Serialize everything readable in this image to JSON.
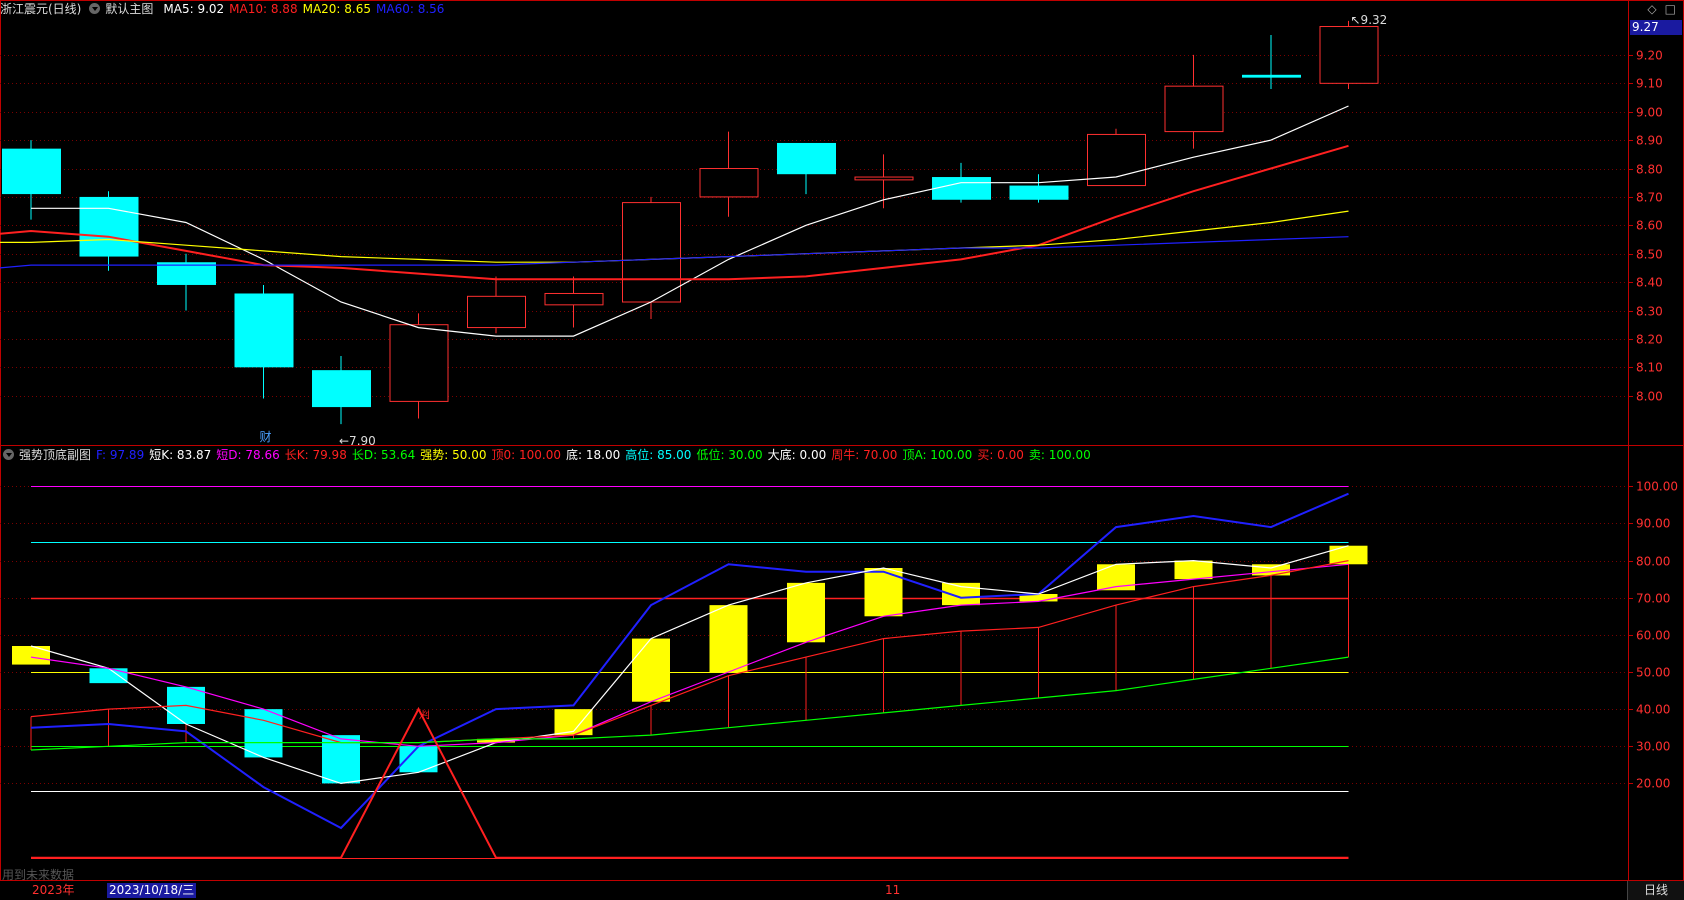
{
  "main_legend": {
    "stock_name": "浙江震元(日线)",
    "chart_name": "默认主图",
    "items": [
      {
        "label": "MA5: 9.02",
        "color": "#ffffff"
      },
      {
        "label": "MA10: 8.88",
        "color": "#ff2020"
      },
      {
        "label": "MA20: 8.65",
        "color": "#ffff00"
      },
      {
        "label": "MA60: 8.56",
        "color": "#2020ff"
      }
    ]
  },
  "sub_legend": {
    "chart_name": "强势顶底副图",
    "items": [
      {
        "label": "F: 97.89",
        "color": "#2020ff"
      },
      {
        "label": "短K: 83.87",
        "color": "#ffffff"
      },
      {
        "label": "短D: 78.66",
        "color": "#ff00ff"
      },
      {
        "label": "长K: 79.98",
        "color": "#ff2020"
      },
      {
        "label": "长D: 53.64",
        "color": "#00ff00"
      },
      {
        "label": "强势: 50.00",
        "color": "#ffff00"
      },
      {
        "label": "顶0: 100.00",
        "color": "#ff2020"
      },
      {
        "label": "底: 18.00",
        "color": "#ffffff"
      },
      {
        "label": "高位: 85.00",
        "color": "#00ffff"
      },
      {
        "label": "低位: 30.00",
        "color": "#00ff00"
      },
      {
        "label": "大底: 0.00",
        "color": "#ffffff"
      },
      {
        "label": "周牛: 70.00",
        "color": "#ff2020"
      },
      {
        "label": "顶A: 100.00",
        "color": "#00ff00"
      },
      {
        "label": "买: 0.00",
        "color": "#ff2020"
      },
      {
        "label": "卖: 100.00",
        "color": "#00ff00"
      }
    ]
  },
  "current_price": "9.27",
  "annotations": {
    "high_label": "9.32",
    "low_label": "7.90",
    "cai_marker": "财",
    "buy_marker": "买",
    "future_note": "用到未来数据"
  },
  "x_axis": {
    "year": "2023年",
    "date_cursor": "2023/10/18/三",
    "month_mark": "11",
    "period": "日线"
  },
  "top_icons": [
    "◇",
    "□"
  ],
  "colors": {
    "up": "#ff3030",
    "down": "#00ffff",
    "grid": "#7a0000",
    "axis": "#c00000",
    "yellow": "#ffff00"
  },
  "chart_data": [
    {
      "type": "candlestick",
      "title": "浙江震元(日线)",
      "ylim": [
        7.83,
        9.33
      ],
      "yticks": [
        8.0,
        8.1,
        8.2,
        8.3,
        8.4,
        8.5,
        8.6,
        8.7,
        8.8,
        8.9,
        9.0,
        9.1,
        9.2
      ],
      "candles": [
        {
          "o": 8.87,
          "h": 8.9,
          "l": 8.62,
          "c": 8.71
        },
        {
          "o": 8.7,
          "h": 8.72,
          "l": 8.44,
          "c": 8.49
        },
        {
          "o": 8.47,
          "h": 8.5,
          "l": 8.3,
          "c": 8.39
        },
        {
          "o": 8.36,
          "h": 8.39,
          "l": 7.99,
          "c": 8.1
        },
        {
          "o": 8.09,
          "h": 8.14,
          "l": 7.9,
          "c": 7.96
        },
        {
          "o": 7.98,
          "h": 8.29,
          "l": 7.92,
          "c": 8.25
        },
        {
          "o": 8.24,
          "h": 8.42,
          "l": 8.22,
          "c": 8.35
        },
        {
          "o": 8.32,
          "h": 8.42,
          "l": 8.24,
          "c": 8.36
        },
        {
          "o": 8.33,
          "h": 8.7,
          "l": 8.27,
          "c": 8.68
        },
        {
          "o": 8.7,
          "h": 8.93,
          "l": 8.63,
          "c": 8.8
        },
        {
          "o": 8.89,
          "h": 8.89,
          "l": 8.71,
          "c": 8.78
        },
        {
          "o": 8.76,
          "h": 8.85,
          "l": 8.66,
          "c": 8.77
        },
        {
          "o": 8.77,
          "h": 8.82,
          "l": 8.68,
          "c": 8.69
        },
        {
          "o": 8.74,
          "h": 8.78,
          "l": 8.68,
          "c": 8.69
        },
        {
          "o": 8.74,
          "h": 8.94,
          "l": 8.74,
          "c": 8.92
        },
        {
          "o": 8.93,
          "h": 9.2,
          "l": 8.87,
          "c": 9.09
        },
        {
          "o": 9.13,
          "h": 9.27,
          "l": 9.08,
          "c": 9.12
        },
        {
          "o": 9.1,
          "h": 9.32,
          "l": 9.08,
          "c": 9.3
        }
      ],
      "series": [
        {
          "name": "MA5",
          "color": "#ffffff",
          "values": [
            8.66,
            8.66,
            8.61,
            8.48,
            8.33,
            8.24,
            8.21,
            8.21,
            8.33,
            8.48,
            8.6,
            8.69,
            8.75,
            8.75,
            8.77,
            8.84,
            8.9,
            9.02
          ]
        },
        {
          "name": "MA10",
          "color": "#ff2020",
          "values": [
            8.57,
            8.58,
            8.56,
            8.51,
            8.46,
            8.45,
            8.43,
            8.41,
            8.41,
            8.41,
            8.41,
            8.42,
            8.45,
            8.48,
            8.53,
            8.63,
            8.72,
            8.8,
            8.88
          ]
        },
        {
          "name": "MA20",
          "color": "#ffff00",
          "values": [
            8.54,
            8.54,
            8.55,
            8.53,
            8.51,
            8.49,
            8.48,
            8.47,
            8.47,
            8.48,
            8.49,
            8.5,
            8.51,
            8.52,
            8.53,
            8.55,
            8.58,
            8.61,
            8.65
          ]
        },
        {
          "name": "MA60",
          "color": "#2020ff",
          "values": [
            8.45,
            8.46,
            8.46,
            8.46,
            8.46,
            8.46,
            8.46,
            8.46,
            8.47,
            8.48,
            8.49,
            8.5,
            8.51,
            8.52,
            8.52,
            8.53,
            8.54,
            8.55,
            8.56
          ]
        }
      ]
    },
    {
      "type": "line",
      "title": "强势顶底副图",
      "ylim": [
        -6,
        106
      ],
      "yticks": [
        20,
        30,
        40,
        50,
        60,
        70,
        80,
        90,
        100
      ],
      "hlines": [
        {
          "value": 100,
          "color": "#ff00ff"
        },
        {
          "value": 85,
          "color": "#00ffff"
        },
        {
          "value": 70,
          "color": "#ff2020"
        },
        {
          "value": 50,
          "color": "#ffff00"
        },
        {
          "value": 30,
          "color": "#00ff00"
        },
        {
          "value": 18,
          "color": "#ffffff"
        },
        {
          "value": 0,
          "color": "#ff2020"
        }
      ],
      "boxes": [
        {
          "a": 57,
          "b": 52,
          "color": "yellow"
        },
        {
          "a": 51,
          "b": 47,
          "color": "cyan"
        },
        {
          "a": 46,
          "b": 36,
          "color": "cyan"
        },
        {
          "a": 40,
          "b": 27,
          "color": "cyan"
        },
        {
          "a": 33,
          "b": 20,
          "color": "cyan"
        },
        {
          "a": 30,
          "b": 23,
          "color": "cyan"
        },
        {
          "a": 32,
          "b": 31,
          "color": "yellow"
        },
        {
          "a": 40,
          "b": 33,
          "color": "yellow"
        },
        {
          "a": 59,
          "b": 42,
          "color": "yellow"
        },
        {
          "a": 68,
          "b": 50,
          "color": "yellow"
        },
        {
          "a": 74,
          "b": 58,
          "color": "yellow"
        },
        {
          "a": 78,
          "b": 65,
          "color": "yellow"
        },
        {
          "a": 74,
          "b": 68,
          "color": "yellow"
        },
        {
          "a": 71,
          "b": 69,
          "color": "yellow"
        },
        {
          "a": 79,
          "b": 72,
          "color": "yellow"
        },
        {
          "a": 80,
          "b": 75,
          "color": "yellow"
        },
        {
          "a": 79,
          "b": 76,
          "color": "yellow"
        },
        {
          "a": 84,
          "b": 79,
          "color": "yellow"
        }
      ],
      "series": [
        {
          "name": "F",
          "color": "#2020ff",
          "values": [
            35,
            36,
            34,
            19,
            8,
            30,
            40,
            41,
            68,
            79,
            77,
            77,
            70,
            71,
            89,
            92,
            89,
            98
          ]
        },
        {
          "name": "短K",
          "color": "#ffffff",
          "values": [
            57,
            51,
            36,
            27,
            20,
            23,
            31,
            34,
            59,
            68,
            74,
            78,
            73,
            71,
            79,
            80,
            78,
            84
          ]
        },
        {
          "name": "短D",
          "color": "#ff00ff",
          "values": [
            54,
            51,
            46,
            40,
            32,
            30,
            31,
            33,
            42,
            50,
            58,
            65,
            68,
            69,
            73,
            75,
            77,
            79
          ]
        },
        {
          "name": "长K",
          "color": "#ff2020",
          "values": [
            38,
            40,
            41,
            37,
            31,
            31,
            32,
            33,
            41,
            49,
            54,
            59,
            61,
            62,
            68,
            73,
            76,
            80
          ]
        },
        {
          "name": "长D",
          "color": "#00ff00",
          "values": [
            29,
            30,
            31,
            31,
            31,
            31,
            32,
            32,
            33,
            35,
            37,
            39,
            41,
            43,
            45,
            48,
            51,
            54
          ]
        },
        {
          "name": "买",
          "color": "#ff2020",
          "values": [
            0,
            0,
            0,
            0,
            0,
            40,
            0,
            0,
            0,
            0,
            0,
            0,
            0,
            0,
            0,
            0,
            0,
            0
          ]
        }
      ]
    }
  ]
}
